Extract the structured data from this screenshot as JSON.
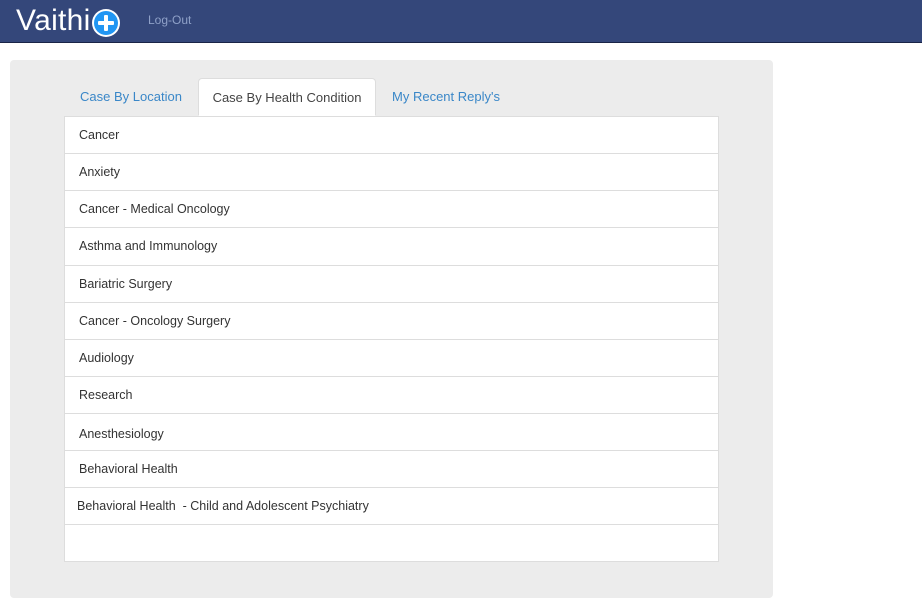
{
  "header": {
    "brand": "Vaithi",
    "brand_icon": "plus-circle-icon",
    "logout_label": "Log-Out",
    "colors": {
      "navbar": "#34477a",
      "icon": "#2196f3"
    }
  },
  "tabs": [
    {
      "label": "Case By Location",
      "active": false
    },
    {
      "label": "Case By Health Condition",
      "active": true
    },
    {
      "label": "My Recent Reply's",
      "active": false
    }
  ],
  "conditions": [
    "Cancer",
    "Anxiety",
    "Cancer - Medical Oncology",
    "Asthma and Immunology",
    "Bariatric Surgery",
    "Cancer - Oncology Surgery",
    "Audiology",
    "Research",
    "Anesthesiology",
    "Behavioral Health",
    "Behavioral Health  - Child and Adolescent Psychiatry",
    ""
  ]
}
